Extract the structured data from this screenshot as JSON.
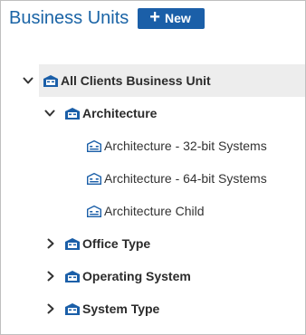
{
  "header": {
    "title": "Business Units",
    "new_button_label": "New",
    "new_button_icon": "plus-icon"
  },
  "colors": {
    "title": "#1a64a6",
    "primary_button": "#1b5fa8",
    "icon_blue": "#1b5fa8",
    "selected_row": "#ededed"
  },
  "tree": {
    "root": {
      "label": "All Clients Business Unit",
      "expanded": true,
      "selected": true,
      "icon": "business-unit-icon"
    },
    "children": [
      {
        "label": "Architecture",
        "expanded": true,
        "icon": "business-unit-icon",
        "children": [
          {
            "label": "Architecture - 32-bit Systems",
            "icon": "business-unit-leaf-icon"
          },
          {
            "label": "Architecture - 64-bit Systems",
            "icon": "business-unit-leaf-icon"
          },
          {
            "label": "Architecture Child",
            "icon": "business-unit-leaf-icon"
          }
        ]
      },
      {
        "label": "Office Type",
        "expanded": false,
        "icon": "business-unit-icon"
      },
      {
        "label": "Operating System",
        "expanded": false,
        "icon": "business-unit-icon"
      },
      {
        "label": "System Type",
        "expanded": false,
        "icon": "business-unit-icon"
      }
    ]
  }
}
